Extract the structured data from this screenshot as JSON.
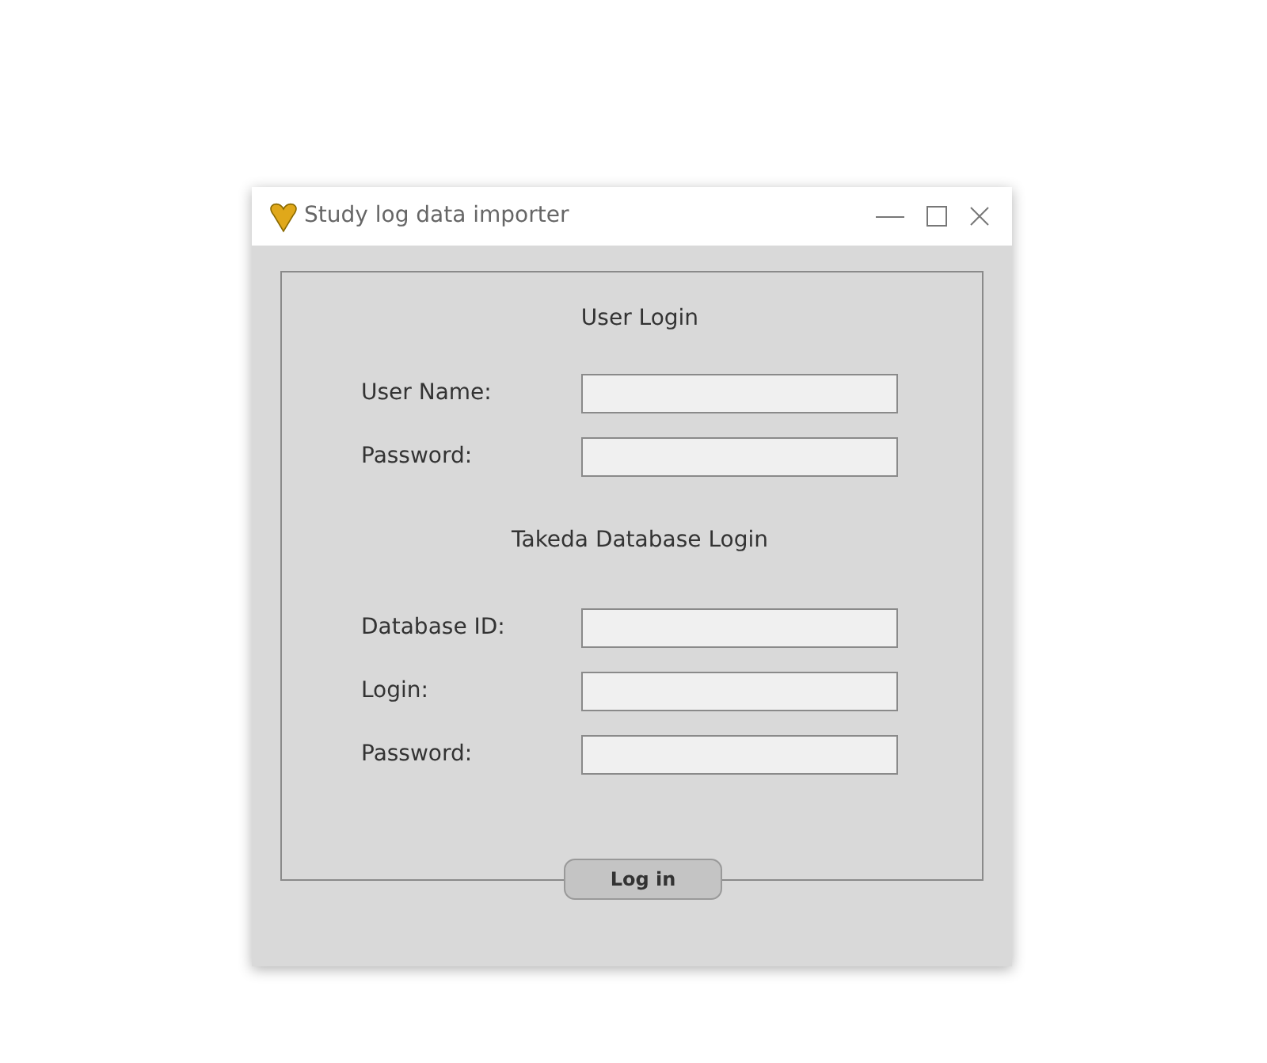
{
  "window": {
    "title": "Study log data importer"
  },
  "sections": [
    {
      "heading": "User Login",
      "fields": [
        {
          "label": "User Name:"
        },
        {
          "label": "Password:"
        }
      ]
    },
    {
      "heading": "Takeda Database Login",
      "fields": [
        {
          "label": "Database ID:"
        },
        {
          "label": "Login:"
        },
        {
          "label": "Password:"
        }
      ]
    }
  ],
  "button": "Log in"
}
